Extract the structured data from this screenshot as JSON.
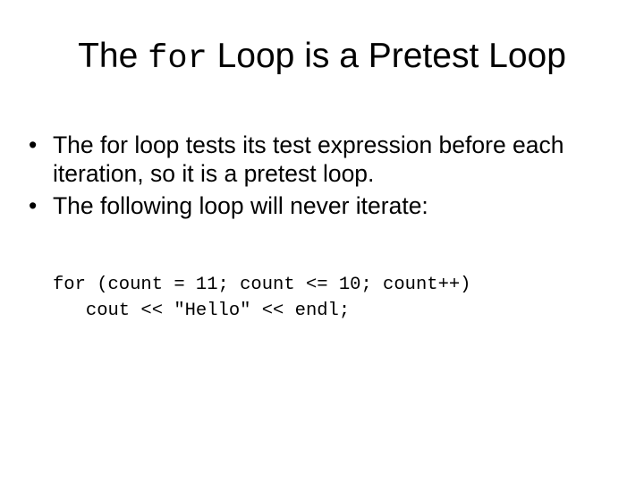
{
  "slide": {
    "title": {
      "before": "The ",
      "code": "for",
      "after": " Loop is a Pretest Loop"
    },
    "bullet_glyph": "•",
    "bullets": [
      {
        "text": "The for loop tests its test expression before each iteration, so it is a pretest loop."
      },
      {
        "text": "The following loop will never iterate:"
      }
    ],
    "code_lines": [
      "for (count = 11; count <= 10; count++)",
      "   cout << \"Hello\" << endl;"
    ]
  }
}
